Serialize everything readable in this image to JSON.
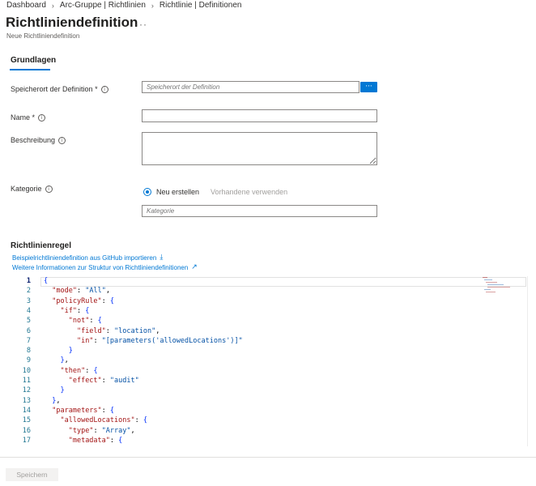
{
  "breadcrumb": [
    "Dashboard",
    "Arc-Gruppe | Richtlinien",
    "Richtlinie | Definitionen"
  ],
  "header": {
    "title": "Richtliniendefinition",
    "more": "···",
    "subtitle": "Neue Richtliniendefinition"
  },
  "tabs": [
    {
      "label": "Grundlagen",
      "active": true
    }
  ],
  "form": {
    "location": {
      "label": "Speicherort der Definition",
      "required": "*",
      "placeholder": "Speicherort der Definition",
      "button": "···"
    },
    "name": {
      "label": "Name",
      "required": "*",
      "value": ""
    },
    "description": {
      "label": "Beschreibung",
      "value": ""
    },
    "category": {
      "label": "Kategorie",
      "options": [
        {
          "label": "Neu erstellen",
          "selected": true
        },
        {
          "label": "Vorhandene verwenden",
          "selected": false,
          "disabled": true
        }
      ],
      "placeholder": "Kategorie"
    }
  },
  "policy_rule": {
    "title": "Richtlinienregel",
    "import_link": "Beispielrichtliniendefinition aus GitHub importieren",
    "info_link": "Weitere Informationen zur Struktur von Richtliniendefinitionen",
    "lines": [
      "{",
      "  \"mode\": \"All\",",
      "  \"policyRule\": {",
      "    \"if\": {",
      "      \"not\": {",
      "        \"field\": \"location\",",
      "        \"in\": \"[parameters('allowedLocations')]\"",
      "      }",
      "    },",
      "    \"then\": {",
      "      \"effect\": \"audit\"",
      "    }",
      "  },",
      "  \"parameters\": {",
      "    \"allowedLocations\": {",
      "      \"type\": \"Array\",",
      "      \"metadata\": {"
    ],
    "line_numbers": [
      "1",
      "2",
      "3",
      "4",
      "5",
      "6",
      "7",
      "8",
      "9",
      "10",
      "11",
      "12",
      "13",
      "14",
      "15",
      "16",
      "17"
    ]
  },
  "footer": {
    "save_label": "Speichern"
  },
  "colors": {
    "accent": "#0078d4",
    "text": "#323130",
    "muted": "#605e5c"
  }
}
